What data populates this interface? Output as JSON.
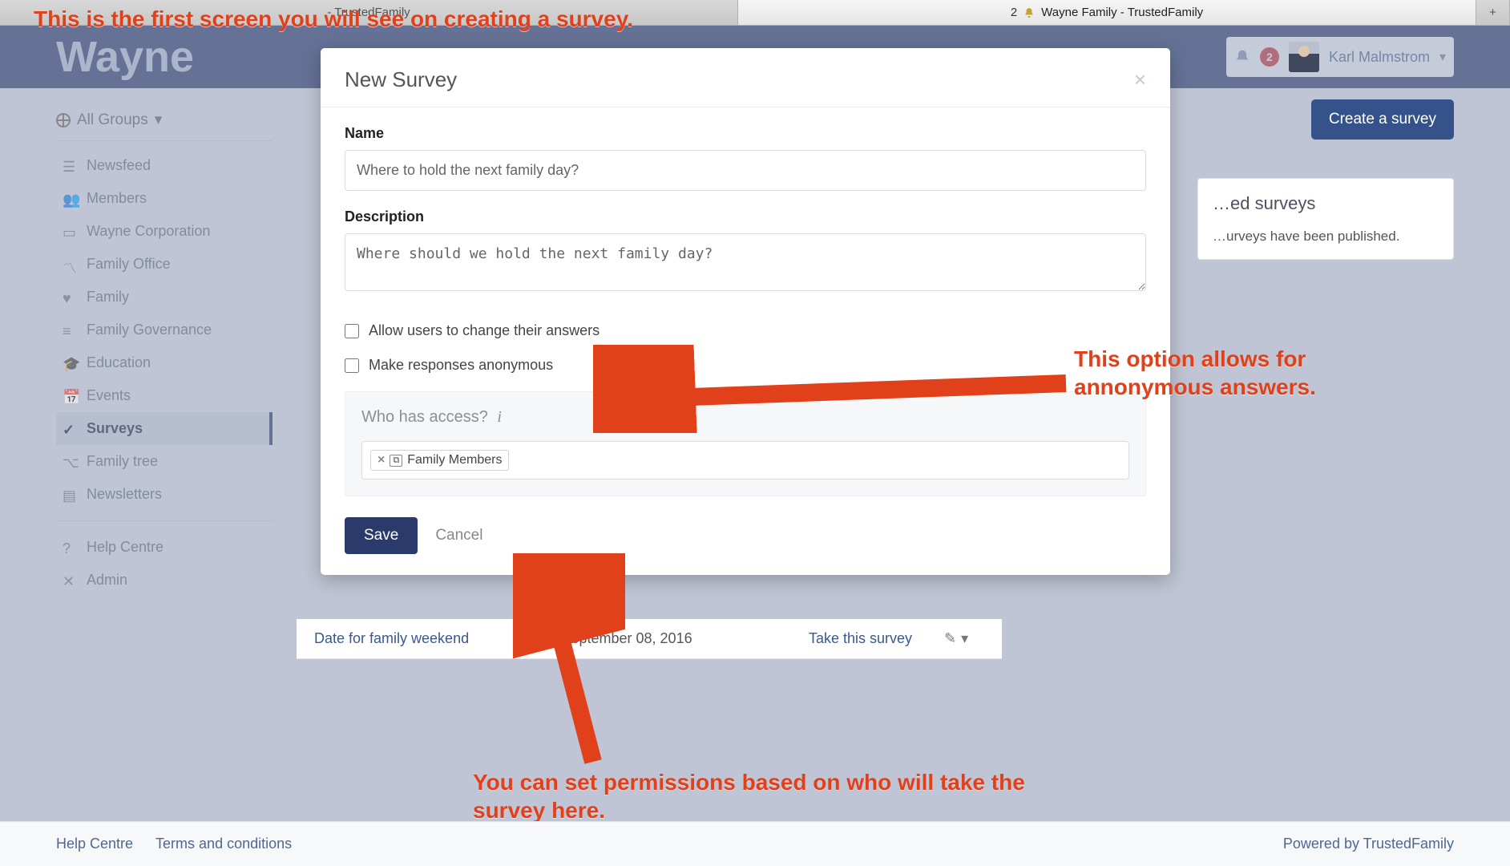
{
  "browserTabs": [
    {
      "label": "- TrustedFamily",
      "count": "",
      "active": false
    },
    {
      "label": "Wayne Family - TrustedFamily",
      "count": "2",
      "active": true
    }
  ],
  "brand": "Wayne",
  "header": {
    "notificationCount": "2",
    "username": "Karl Malmstrom"
  },
  "groupSelector": "All Groups",
  "sidebar": {
    "items": [
      {
        "label": "Newsfeed",
        "active": false
      },
      {
        "label": "Members",
        "active": false
      },
      {
        "label": "Wayne Corporation",
        "active": false
      },
      {
        "label": "Family Office",
        "active": false
      },
      {
        "label": "Family",
        "active": false
      },
      {
        "label": "Family Governance",
        "active": false
      },
      {
        "label": "Education",
        "active": false
      },
      {
        "label": "Events",
        "active": false
      },
      {
        "label": "Surveys",
        "active": true
      },
      {
        "label": "Family tree",
        "active": false
      },
      {
        "label": "Newsletters",
        "active": false
      }
    ],
    "footerItems": [
      {
        "label": "Help Centre"
      },
      {
        "label": "Admin"
      }
    ]
  },
  "main": {
    "createButton": "Create a survey",
    "rightPanel": {
      "titleSuffix": "ed surveys",
      "line1Suffix": "urveys have been published."
    },
    "survey": {
      "name": "Date for family weekend",
      "date": "September 08, 2016",
      "link": "Take this survey"
    }
  },
  "modal": {
    "title": "New Survey",
    "nameLabel": "Name",
    "nameValue": "Where to hold the next family day?",
    "descLabel": "Description",
    "descValue": "Where should we hold the next family day?",
    "allowChange": "Allow users to change their answers",
    "anonymous": "Make responses anonymous",
    "accessTitle": "Who has access?",
    "accessTag": "Family Members",
    "save": "Save",
    "cancel": "Cancel"
  },
  "footer": {
    "help": "Help Centre",
    "terms": "Terms and conditions",
    "powered": "Powered by TrustedFamily"
  },
  "annotations": {
    "top": "This is the first screen you will see on creating a survey.",
    "anonymous": "This option allows for annonymous answers.",
    "permissions": "You can set permissions based on who will take the survey here."
  }
}
